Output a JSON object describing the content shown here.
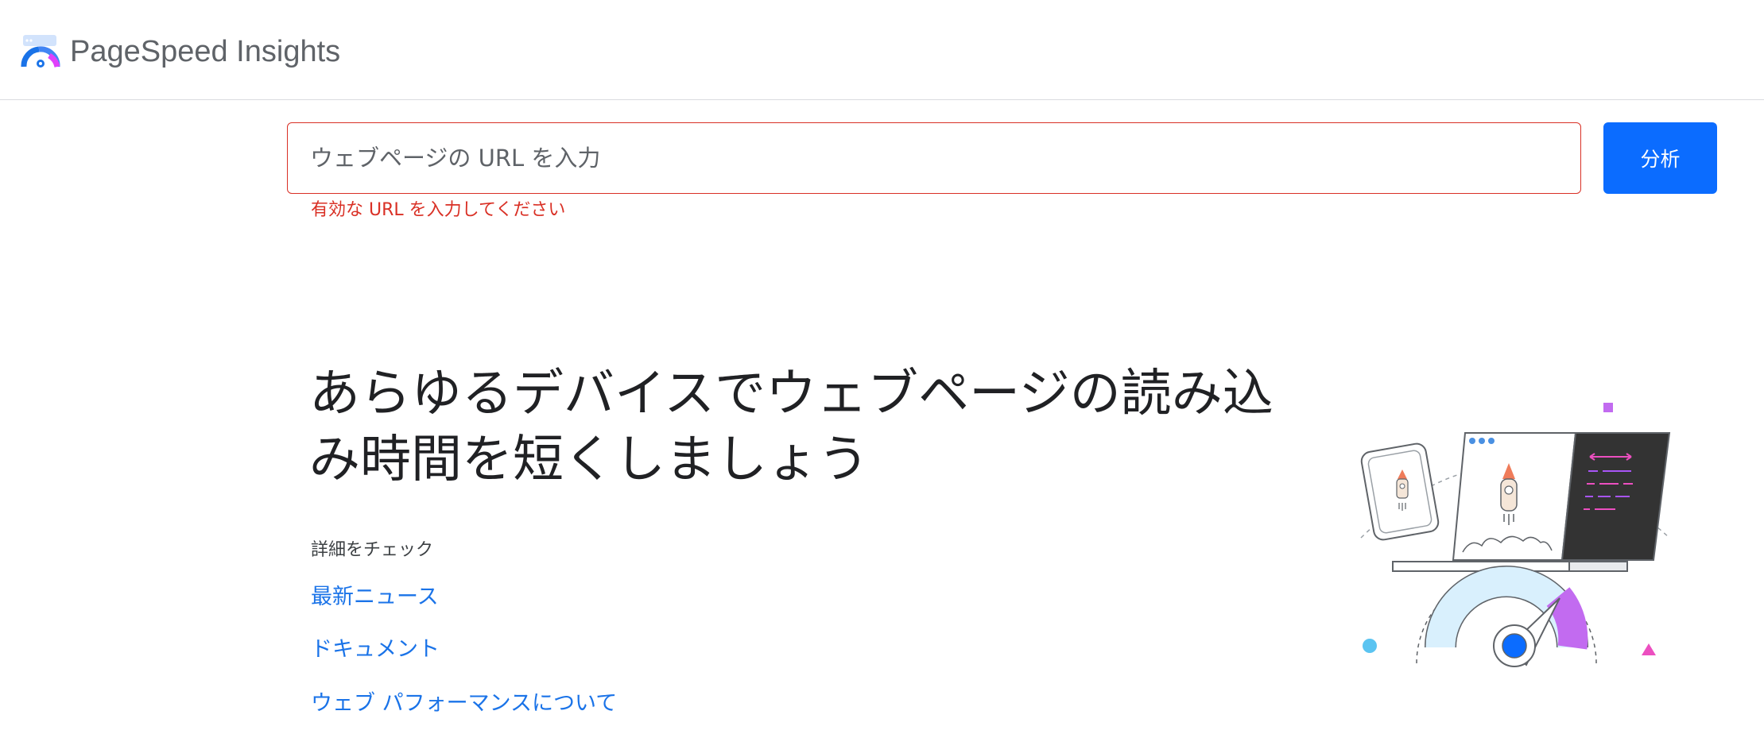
{
  "header": {
    "app_title": "PageSpeed Insights",
    "logo_icon": "pagespeed-gauge-icon"
  },
  "search": {
    "placeholder": "ウェブページの URL を入力",
    "value": "",
    "analyze_label": "分析",
    "error_message": "有効な URL を入力してください"
  },
  "hero": {
    "headline": "あらゆるデバイスでウェブページの読み込み時間を短くしましょう",
    "learn_more_label": "詳細をチェック",
    "links": [
      "最新ニュース",
      "ドキュメント",
      "ウェブ パフォーマンスについて"
    ],
    "illustration_icon": "devices-speed-gauge-illustration"
  },
  "colors": {
    "accent": "#0b6cff",
    "error": "#d93025",
    "link": "#1a73e8",
    "title": "#5f6368"
  }
}
